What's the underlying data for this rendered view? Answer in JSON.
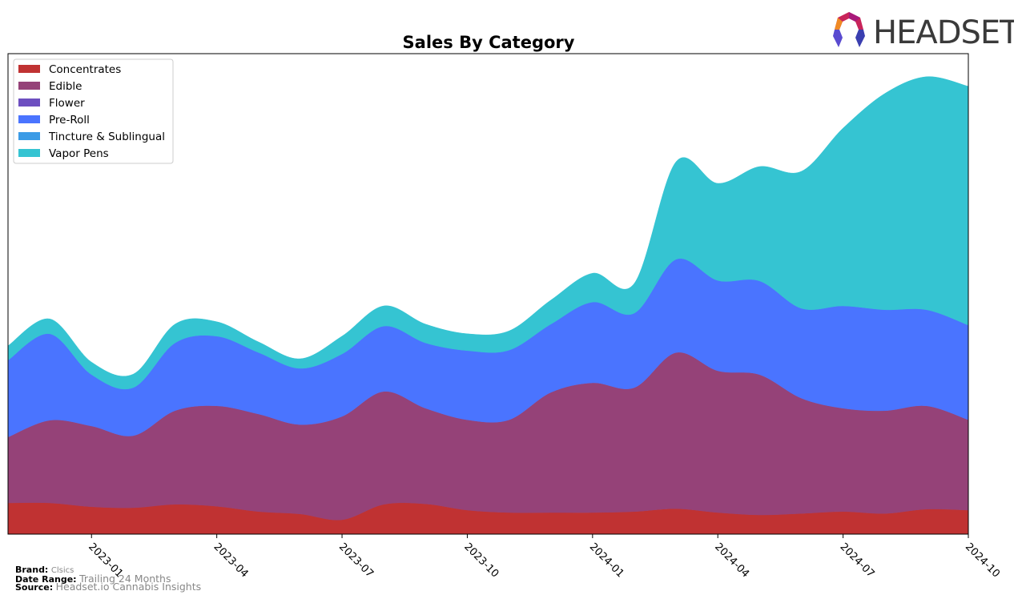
{
  "chart_data": {
    "type": "area",
    "stacked": true,
    "smoothed": true,
    "title": "Sales By Category",
    "xlabel": "",
    "ylabel": "",
    "y_units": "relative (no axis labels shown)",
    "ylim": [
      0,
      100
    ],
    "grid": false,
    "legend_position": "top-left",
    "x": [
      "2022-11",
      "2022-12",
      "2023-01",
      "2023-02",
      "2023-03",
      "2023-04",
      "2023-05",
      "2023-06",
      "2023-07",
      "2023-08",
      "2023-09",
      "2023-10",
      "2023-11",
      "2023-12",
      "2024-01",
      "2024-02",
      "2024-03",
      "2024-04",
      "2024-05",
      "2024-06",
      "2024-07",
      "2024-08",
      "2024-09",
      "2024-10"
    ],
    "x_ticks": [
      "2023-01",
      "2023-04",
      "2023-07",
      "2023-10",
      "2024-01",
      "2024-04",
      "2024-07",
      "2024-10"
    ],
    "series": [
      {
        "name": "Concentrates",
        "color": "#c03232",
        "values": [
          6.5,
          6.5,
          5.7,
          5.5,
          6.2,
          5.8,
          4.7,
          4.2,
          3.0,
          6.2,
          6.3,
          5.0,
          4.5,
          4.5,
          4.5,
          4.7,
          5.3,
          4.5,
          4.0,
          4.3,
          4.7,
          4.3,
          5.2,
          5.0
        ]
      },
      {
        "name": "Edible",
        "color": "#954278",
        "values": [
          13.7,
          17.2,
          16.8,
          15.0,
          19.5,
          20.9,
          20.3,
          18.6,
          21.5,
          23.5,
          19.9,
          18.8,
          19.3,
          25.0,
          27.0,
          25.8,
          32.5,
          29.5,
          29.2,
          24.0,
          21.5,
          21.4,
          21.5,
          18.8
        ]
      },
      {
        "name": "Flower",
        "color": "#6d4fc0",
        "values": [
          0,
          0,
          0,
          0,
          0,
          0,
          0,
          0,
          0,
          0,
          0,
          0,
          0,
          0,
          0,
          0,
          0,
          0,
          0,
          0,
          0,
          0,
          0,
          0
        ]
      },
      {
        "name": "Pre-Roll",
        "color": "#4a74ff",
        "values": [
          16.0,
          18.0,
          10.7,
          10.0,
          14.1,
          14.5,
          12.8,
          11.7,
          13.0,
          13.6,
          13.6,
          14.4,
          14.5,
          14.2,
          16.8,
          15.5,
          19.4,
          18.8,
          19.5,
          18.7,
          21.3,
          21.0,
          20.0,
          19.7
        ]
      },
      {
        "name": "Tincture & Sublingual",
        "color": "#3b9be6",
        "values": [
          0,
          0,
          0,
          0,
          0,
          0,
          0,
          0,
          0,
          0,
          0,
          0,
          0,
          0,
          0,
          0,
          0,
          0,
          0,
          0,
          0,
          0,
          0,
          0
        ]
      },
      {
        "name": "Vapor Pens",
        "color": "#35c4d2",
        "values": [
          3.0,
          3.1,
          2.6,
          2.8,
          3.9,
          3.0,
          2.2,
          2.0,
          3.7,
          4.2,
          3.9,
          3.5,
          4.0,
          5.0,
          6.0,
          6.2,
          20.3,
          20.2,
          23.8,
          28.5,
          37.0,
          45.0,
          48.5,
          49.7
        ]
      }
    ]
  },
  "footer": {
    "brand_label": "Brand:",
    "brand_value": "Clsics",
    "date_range_label": "Date Range:",
    "date_range_value": "Trailing 24 Months",
    "source_label": "Source:",
    "source_value": "Headset.io Cannabis Insights"
  },
  "logo": {
    "text": "HEADSET"
  }
}
